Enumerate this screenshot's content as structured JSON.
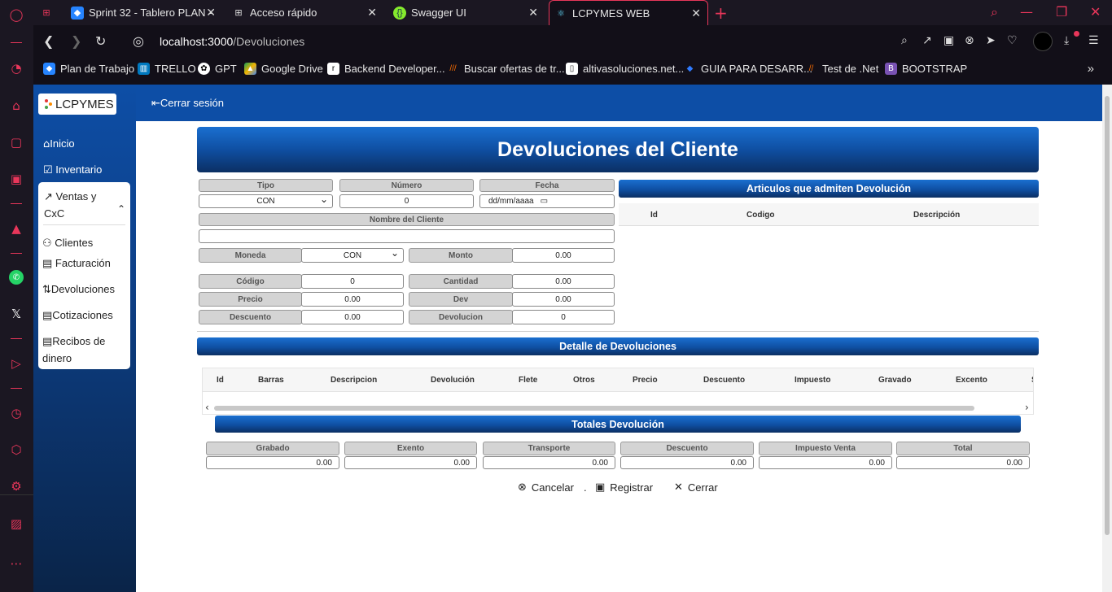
{
  "browser": {
    "tabs": [
      {
        "title": "Sprint 32 - Tablero PLAN -"
      },
      {
        "title": "Acceso rápido"
      },
      {
        "title": "Swagger UI"
      },
      {
        "title": "LCPYMES WEB"
      }
    ],
    "url_host": "localhost:3000",
    "url_path": "/Devoluciones",
    "bookmarks": [
      {
        "label": "Plan de Trabajo"
      },
      {
        "label": "TRELLO"
      },
      {
        "label": "GPT"
      },
      {
        "label": "Google Drive"
      },
      {
        "label": "Backend Developer..."
      },
      {
        "label": "Buscar ofertas de tr..."
      },
      {
        "label": "altivasoluciones.net..."
      },
      {
        "label": "GUIA PARA DESARR..."
      },
      {
        "label": "Test de .Net"
      },
      {
        "label": "BOOTSTRAP"
      }
    ]
  },
  "app": {
    "brand": "LCPYMES",
    "logout": "Cerrar sesión",
    "nav": {
      "inicio": "Inicio",
      "inventario": "Inventario",
      "ventas": "Ventas y CxC",
      "clientes": "Clientes",
      "facturacion": "Facturación",
      "devoluciones": "Devoluciones",
      "cotizaciones": "Cotizaciones",
      "recibos": "Recibos de dinero"
    }
  },
  "form": {
    "title": "Devoluciones del Cliente",
    "tipo_label": "Tipo",
    "tipo_value": "CON",
    "numero_label": "Número",
    "numero_value": "0",
    "fecha_label": "Fecha",
    "fecha_placeholder": "dd/mm/aaaa",
    "cliente_label": "Nombre del Cliente",
    "cliente_value": "",
    "moneda_label": "Moneda",
    "moneda_value": "CON",
    "monto_label": "Monto",
    "monto_value": "0.00",
    "codigo_label": "Código",
    "codigo_value": "0",
    "cantidad_label": "Cantidad",
    "cantidad_value": "0.00",
    "precio_label": "Precio",
    "precio_value": "0.00",
    "dev_label": "Dev",
    "dev_value": "0.00",
    "descuento_label": "Descuento",
    "descuento_value": "0.00",
    "devolucion_label": "Devolucion",
    "devolucion_value": "0"
  },
  "articulos": {
    "title": "Articulos que admiten Devolución",
    "columns": [
      "Id",
      "Codigo",
      "Descripción"
    ]
  },
  "detalle": {
    "title": "Detalle de Devoluciones",
    "columns": [
      "Id",
      "Barras",
      "Descripcion",
      "Devolución",
      "Flete",
      "Otros",
      "Precio",
      "Descuento",
      "Impuesto",
      "Gravado",
      "Excento",
      "S"
    ]
  },
  "totales": {
    "title": "Totales Devolución",
    "items": [
      {
        "label": "Grabado",
        "value": "0.00"
      },
      {
        "label": "Exento",
        "value": "0.00"
      },
      {
        "label": "Transporte",
        "value": "0.00"
      },
      {
        "label": "Descuento",
        "value": "0.00"
      },
      {
        "label": "Impuesto Venta",
        "value": "0.00"
      },
      {
        "label": "Total",
        "value": "0.00"
      }
    ]
  },
  "actions": {
    "cancelar": "Cancelar",
    "separator": ".",
    "registrar": "Registrar",
    "cerrar": "Cerrar"
  },
  "colors": {
    "opera_accent": "#e8365a",
    "header_blue": "#0d4ea6"
  }
}
